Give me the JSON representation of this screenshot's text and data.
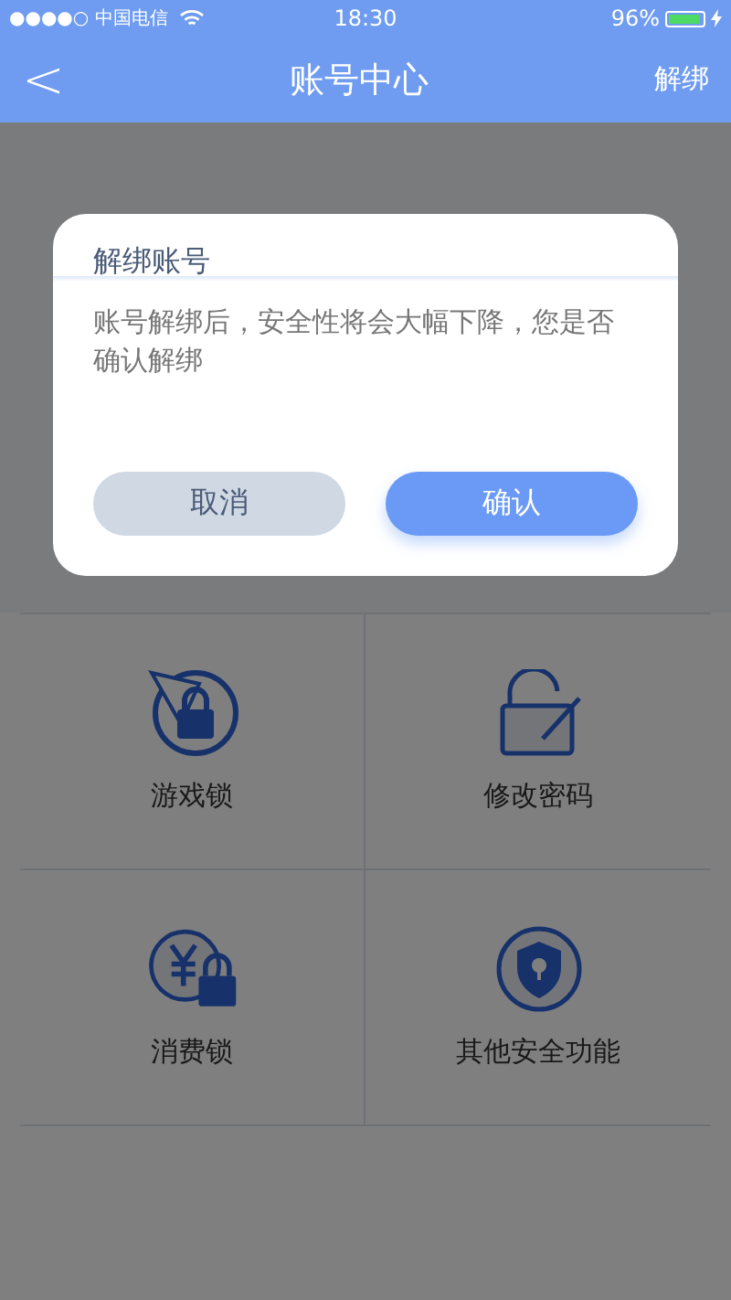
{
  "status_bar": {
    "carrier": "●●●●○ 中国电信",
    "time": "18:30",
    "battery": "96%"
  },
  "nav": {
    "back": "<",
    "title": "账号中心",
    "action": "解绑"
  },
  "grid": [
    {
      "label": "游戏锁",
      "kind": "game"
    },
    {
      "label": "修改密码",
      "kind": "password"
    },
    {
      "label": "消费锁",
      "kind": "payment"
    },
    {
      "label": "其他安全功能",
      "kind": "shield"
    }
  ],
  "dialog": {
    "title": "解绑账号",
    "message": "账号解绑后，安全性将会大幅下降，您是否确认解绑",
    "buttons": [
      {
        "label": "取消",
        "kind": "cancel"
      },
      {
        "label": "确认",
        "kind": "confirm"
      }
    ]
  }
}
